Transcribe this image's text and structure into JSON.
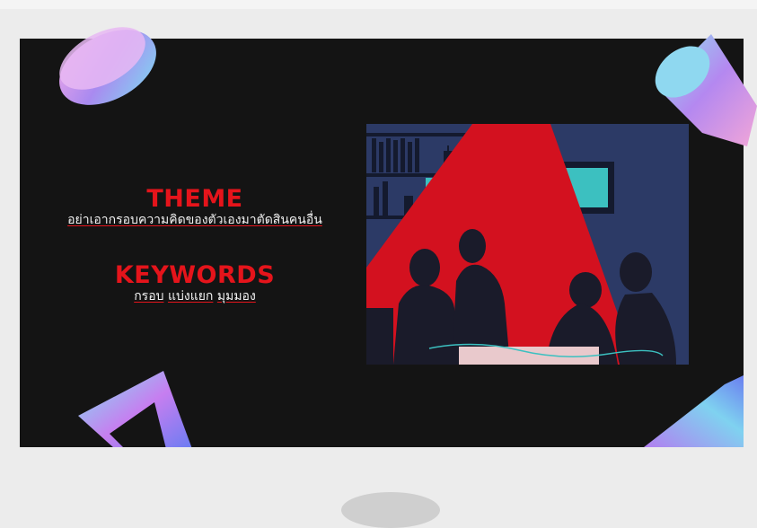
{
  "slide": {
    "theme_heading": "THEME",
    "theme_text": "อย่าเอากรอบความคิดของตัวเองมาตัดสินคนอื่น",
    "keywords_heading": "KEYWORDS",
    "keywords": [
      "กรอบ",
      "แบ่งแยก",
      "มุมมอง"
    ]
  },
  "colors": {
    "slide_background": "#141414",
    "accent": "#e5141b",
    "illustration_wall": "#2c3a66",
    "page_background": "#ececec"
  },
  "icons": [
    "holographic-disc-icon",
    "holographic-cylinder-icon",
    "holographic-frame-icon",
    "holographic-prism-icon"
  ]
}
